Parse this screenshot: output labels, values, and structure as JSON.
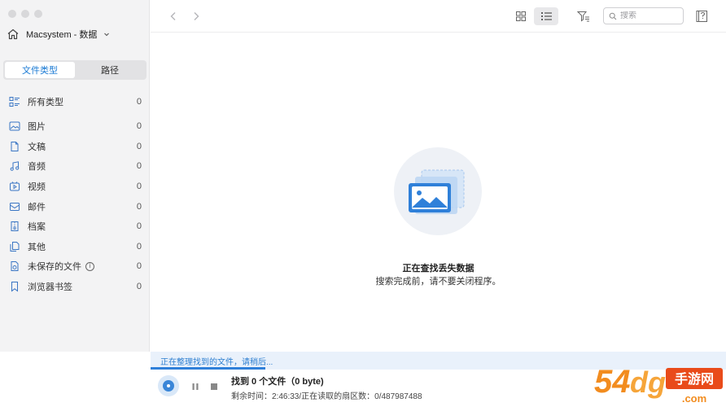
{
  "sidebar": {
    "device_name": "Macsystem - 数据",
    "tabs": [
      {
        "label": "文件类型",
        "active": true
      },
      {
        "label": "路径",
        "active": false
      }
    ],
    "categories": [
      {
        "label": "所有类型",
        "count": "0",
        "icon": "all-types-icon"
      },
      {
        "label": "图片",
        "count": "0",
        "icon": "image-icon"
      },
      {
        "label": "文稿",
        "count": "0",
        "icon": "document-icon"
      },
      {
        "label": "音频",
        "count": "0",
        "icon": "audio-icon"
      },
      {
        "label": "视频",
        "count": "0",
        "icon": "video-icon"
      },
      {
        "label": "邮件",
        "count": "0",
        "icon": "mail-icon"
      },
      {
        "label": "档案",
        "count": "0",
        "icon": "archive-icon"
      },
      {
        "label": "其他",
        "count": "0",
        "icon": "other-icon"
      },
      {
        "label": "未保存的文件",
        "count": "0",
        "icon": "unsaved-file-icon"
      },
      {
        "label": "浏览器书签",
        "count": "0",
        "icon": "bookmark-icon"
      }
    ]
  },
  "toolbar": {
    "search_placeholder": "搜索"
  },
  "main": {
    "status_title": "正在查找丢失数据",
    "status_subtitle": "搜索完成前，请不要关闭程序。"
  },
  "footer": {
    "scan_message": "正在整理找到的文件，请稍后...",
    "progress": 0.2,
    "found_text": "找到 0 个文件（0 byte)",
    "remaining_text": "剩余时间：2:46:33/正在读取的扇区数：0/487987488"
  },
  "watermark": {
    "text": "54dg 手游网",
    "sub": ".com"
  },
  "colors": {
    "accent": "#2f80d9",
    "sidebar_bg": "#f3f3f4"
  }
}
